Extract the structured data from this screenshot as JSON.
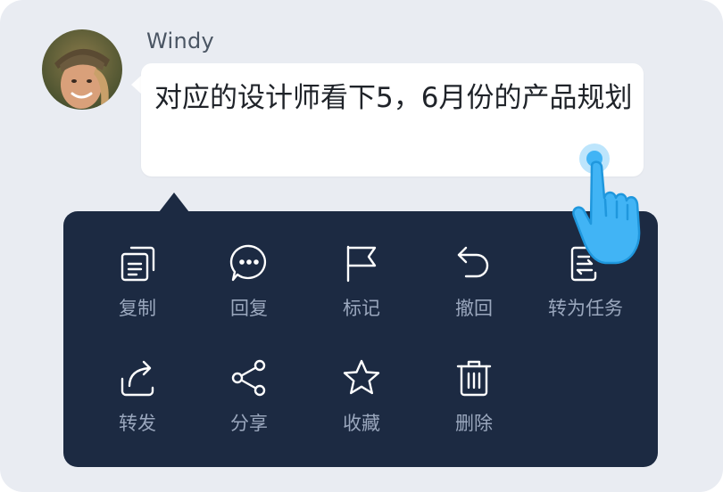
{
  "chat": {
    "sender_name": "Windy",
    "message_text": "对应的设计师看下5，6月份的产品规划"
  },
  "menu": {
    "items": [
      {
        "label": "复制",
        "icon": "copy-icon"
      },
      {
        "label": "回复",
        "icon": "reply-bubble-icon"
      },
      {
        "label": "标记",
        "icon": "flag-icon"
      },
      {
        "label": "撤回",
        "icon": "undo-icon"
      },
      {
        "label": "转为任务",
        "icon": "convert-to-task-icon"
      },
      {
        "label": "转发",
        "icon": "forward-icon"
      },
      {
        "label": "分享",
        "icon": "share-icon"
      },
      {
        "label": "收藏",
        "icon": "star-icon"
      },
      {
        "label": "删除",
        "icon": "trash-icon"
      }
    ]
  },
  "colors": {
    "background": "#e9ecf2",
    "menu_background": "#1c2a42",
    "menu_text": "#9aa7bd",
    "icon_stroke": "#ffffff",
    "message_text": "#1f2329",
    "hand": "#41b4f5"
  }
}
